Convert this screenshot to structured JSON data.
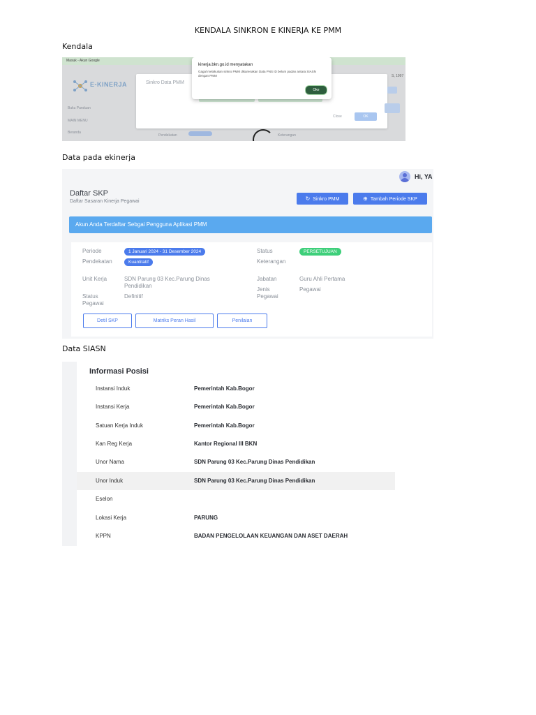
{
  "doc_title": "KENDALA SINKRON E KINERJA KE PMM",
  "sections": {
    "kendala": "Kendala",
    "ekinerja": "Data pada ekinerja",
    "siasn": "Data SIASN"
  },
  "shot1": {
    "tab_title": "Masuk - Akun Google",
    "logo_text": "E-KINERJA",
    "sidebar": [
      "Buku Panduan",
      "MAIN MENU",
      "Beranda"
    ],
    "modal_title": "Sinkro Data PMM",
    "modal_close": "Close",
    "modal_ok": "OK",
    "alert_title": "kinerja.bkn.go.id menyatakan",
    "alert_body": "Gagal melakukan sinkro PMM dikarenakan Data PNS ID belum padan antara SIASN dengan PMM",
    "alert_ok": "Oke",
    "bottom_labels": [
      "Pendekatan",
      "Keterangan"
    ],
    "right_text": "S, 1997"
  },
  "shot2": {
    "user": "Hi, YA",
    "title": "Daftar SKP",
    "subtitle": "Daftar Sasaran Kinerja Pegawai",
    "btn_sinkro": "Sinkro PMM",
    "btn_tambah": "Tambah Periode SKP",
    "banner": "Akun Anda Terdaftar Sebgai Pengguna Aplikasi PMM",
    "labels": {
      "periode": "Periode",
      "pendekatan": "Pendekatan",
      "unit_kerja": "Unit Kerja",
      "status_pegawai": "Status Pegawai",
      "status": "Status",
      "keterangan": "Keterangan",
      "jabatan": "Jabatan",
      "jenis_pegawai": "Jenis Pegawai"
    },
    "values": {
      "periode": "1 Januari 2024 - 31 Desember 2024",
      "pendekatan": "Kuantitatif",
      "unit_kerja": "SDN Parung 03 Kec.Parung Dinas Pendidikan",
      "status_pegawai": "Definitif",
      "status": "PERSETUJUAN",
      "jabatan": "Guru Ahli Pertama",
      "jenis_pegawai": "Pegawai"
    },
    "buttons": [
      "Detil SKP",
      "Matriks Peran Hasil",
      "Penilaian"
    ],
    "colors": {
      "primary": "#4b7bec",
      "banner": "#5aa9ef",
      "status_green": "#3ecf7a"
    }
  },
  "shot3": {
    "title": "Informasi Posisi",
    "rows": [
      {
        "label": "Instansi Induk",
        "value": "Pemerintah Kab.Bogor"
      },
      {
        "label": "Instansi Kerja",
        "value": "Pemerintah Kab.Bogor"
      },
      {
        "label": "Satuan Kerja Induk",
        "value": "Pemerintah Kab.Bogor"
      },
      {
        "label": "Kan Reg Kerja",
        "value": "Kantor Regional III BKN"
      },
      {
        "label": "Unor Nama",
        "value": "SDN Parung 03 Kec.Parung Dinas Pendidikan"
      },
      {
        "label": "Unor Induk",
        "value": "SDN Parung 03 Kec.Parung Dinas Pendidikan"
      },
      {
        "label": "Eselon",
        "value": ""
      },
      {
        "label": "Lokasi Kerja",
        "value": "PARUNG"
      },
      {
        "label": "KPPN",
        "value": "BADAN PENGELOLAAN KEUANGAN DAN ASET DAERAH"
      }
    ]
  }
}
